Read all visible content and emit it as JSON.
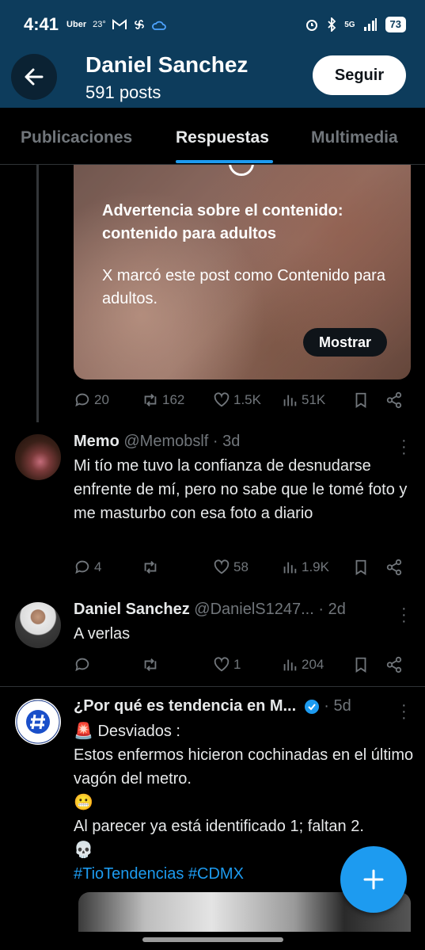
{
  "status_bar": {
    "time": "4:41",
    "uber": "Uber",
    "temperature": "23°",
    "network": "5G",
    "battery": "73"
  },
  "header": {
    "name": "Daniel Sanchez",
    "posts": "591 posts",
    "follow_label": "Seguir"
  },
  "tabs": [
    "Publicaciones",
    "Respuestas",
    "Multimedia"
  ],
  "active_tab": "Respuestas",
  "warning": {
    "title": "Advertencia sobre el contenido: contenido para adultos",
    "body": "X marcó este post como Contenido para adultos.",
    "show_label": "Mostrar"
  },
  "post0_stats": {
    "replies": "20",
    "reposts": "162",
    "likes": "1.5K",
    "views": "51K"
  },
  "tweets": [
    {
      "name": "Memo",
      "handle": "@Memobslf",
      "time": "· 3d",
      "text": "Mi tío me tuvo la confianza de desnudarse enfrente de mí, pero no sabe que le tomé foto y me masturbo con esa foto a diario",
      "replies": "4",
      "reposts": "",
      "likes": "58",
      "views": "1.9K"
    },
    {
      "name": "Daniel Sanchez",
      "handle": "@DanielS1247...",
      "time": "· 2d",
      "text": "A verlas",
      "replies": "",
      "reposts": "",
      "likes": "1",
      "views": "204"
    },
    {
      "name": "¿Por qué es tendencia en M...",
      "handle": "",
      "time": "· 5d",
      "line1": "🚨 Desviados :",
      "line2": "Estos enfermos hicieron cochinadas en el último vagón del metro.",
      "line3": "😬",
      "line4": "Al parecer ya está identificado 1; faltan 2.",
      "line5": "💀",
      "hashtags": "#TioTendencias #CDMX"
    }
  ],
  "colors": {
    "header_bg": "#0d3c5c",
    "accent": "#1d9bf0",
    "muted": "#71767b"
  }
}
